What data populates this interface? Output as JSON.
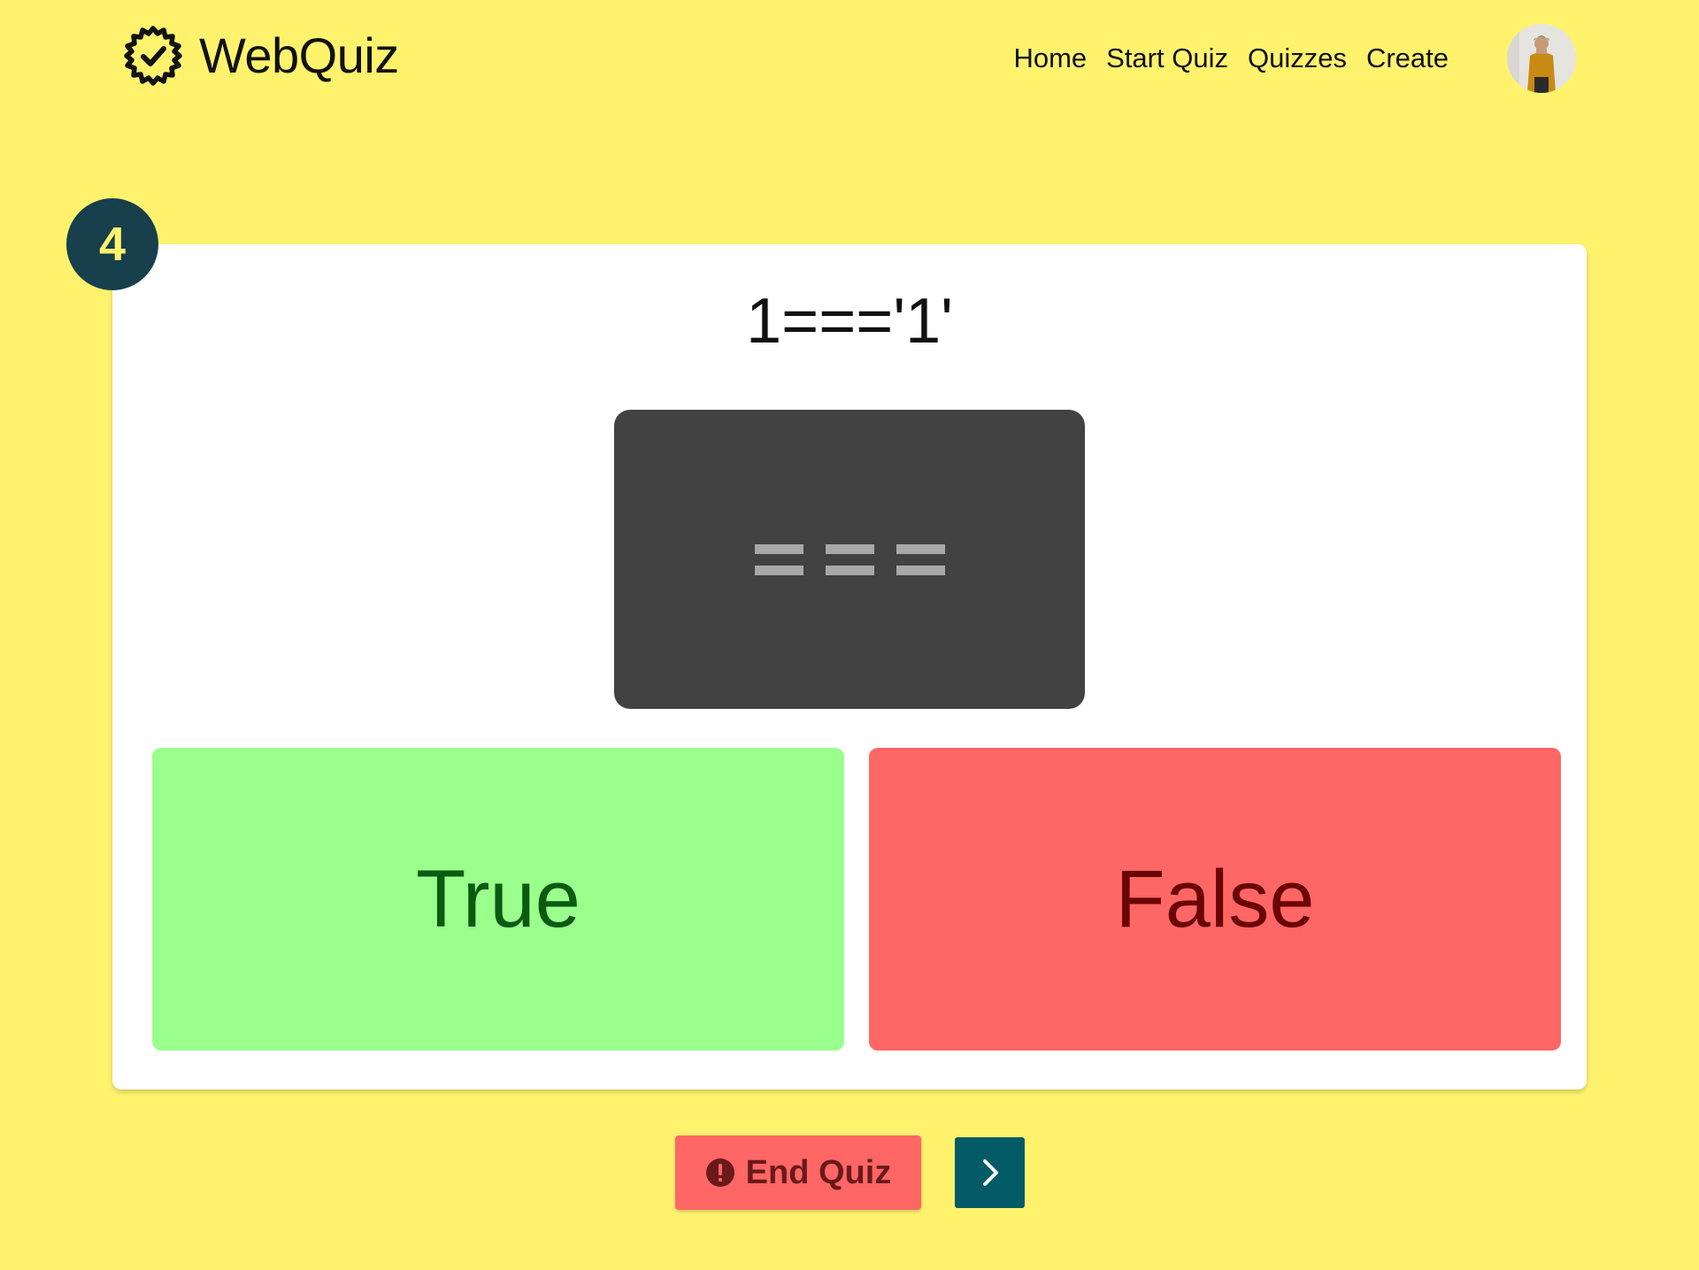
{
  "header": {
    "brand_name": "WebQuiz",
    "nav": [
      {
        "label": "Home"
      },
      {
        "label": "Start Quiz"
      },
      {
        "label": "Quizzes"
      },
      {
        "label": "Create"
      }
    ]
  },
  "question": {
    "number": "4",
    "text": "1==='1'",
    "answers": [
      {
        "label": "True"
      },
      {
        "label": "False"
      }
    ]
  },
  "controls": {
    "end_label": "End Quiz"
  },
  "colors": {
    "background": "#fff36e",
    "badge": "#173f4c",
    "true_bg": "#9bff8d",
    "false_bg": "#ff6666",
    "next_bg": "#055a68"
  },
  "icons": [
    "gear-check-logo-icon",
    "user-avatar",
    "equals-image-icon",
    "alert-circle-icon",
    "chevron-right-icon"
  ]
}
